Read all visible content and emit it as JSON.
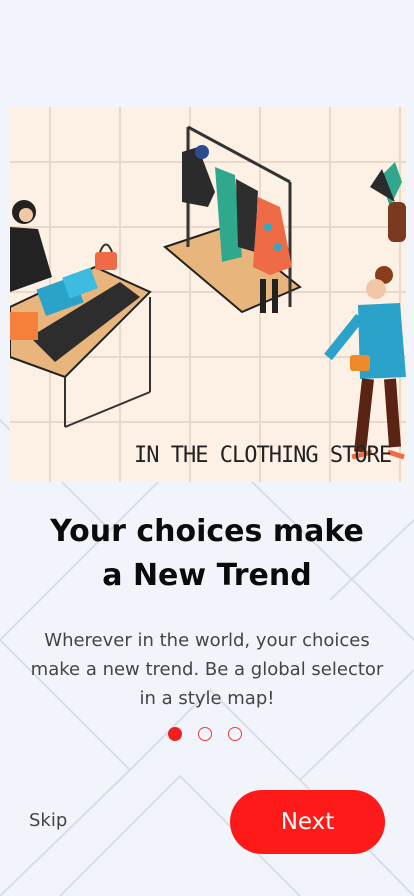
{
  "onboarding": {
    "illustration_caption": "IN THE CLOTHING STORE",
    "title": "Your choices make\na New Trend",
    "description": "Wherever in the world, your choices make a new trend. Be a global selector in a style map!",
    "page_indicator": {
      "current": 1,
      "total": 3
    },
    "skip_label": "Skip",
    "next_label": "Next"
  },
  "colors": {
    "accent": "#ff1a1a",
    "background": "#f1f4fb",
    "illustration_bg": "#fdf1e6"
  }
}
